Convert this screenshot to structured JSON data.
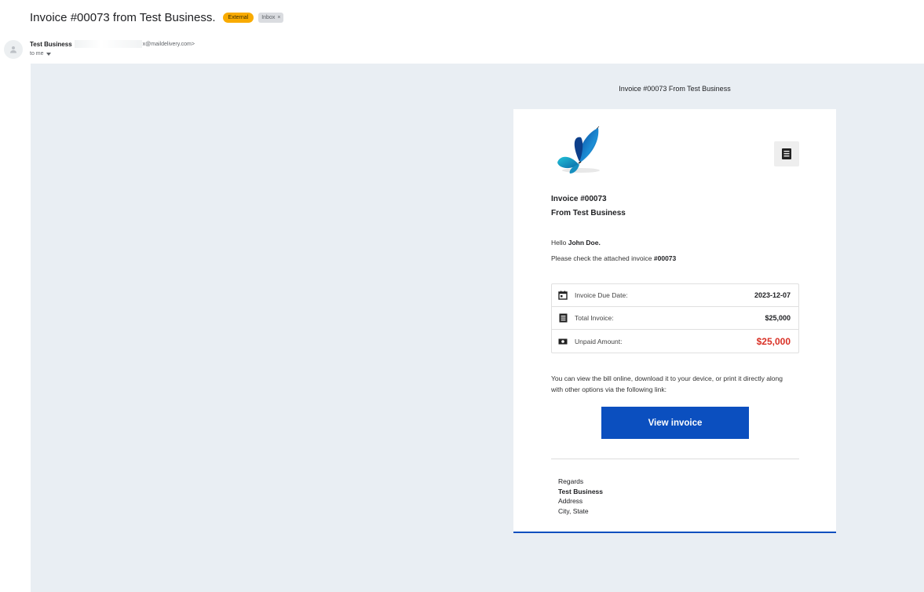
{
  "email": {
    "subject": "Invoice #00073 from Test Business.",
    "labels": {
      "external": "External",
      "inbox": "Inbox",
      "inbox_close": "×"
    },
    "sender_name": "Test Business",
    "sender_email": "x@maildelivery.com>",
    "to_text": "to me"
  },
  "invoice": {
    "header": "Invoice #00073 From Test Business",
    "title_line1": "Invoice #00073",
    "title_line2": "From Test Business",
    "greeting_prefix": "Hello ",
    "customer_name": "John Doe.",
    "check_text": "Please check the attached invoice ",
    "invoice_ref": "#00073",
    "details": [
      {
        "icon": "calendar-icon",
        "label": "Invoice Due Date:",
        "value": "2023-12-07"
      },
      {
        "icon": "document-icon",
        "label": "Total Invoice:",
        "value": "$25,000"
      },
      {
        "icon": "cash-icon",
        "label": "Unpaid Amount:",
        "value": "$25,000"
      }
    ],
    "note": "You can view the bill online, download it to your device, or print it directly along with other options via the following link:",
    "button_label": "View invoice",
    "signature": {
      "regards": "Regards",
      "company": "Test Business",
      "address": "Address",
      "city": "City, State"
    }
  },
  "colors": {
    "accent": "#0b4fbf",
    "unpaid": "#d93025",
    "external_badge": "#f9ab00",
    "email_bg": "#e9eef3"
  }
}
